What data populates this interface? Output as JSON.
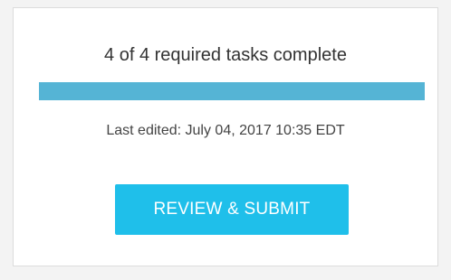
{
  "card": {
    "summary": "4 of 4 required tasks complete",
    "progress": {
      "completed": 4,
      "required": 4,
      "fraction": 1.0,
      "color": "#55b4d5"
    },
    "last_edited": "Last edited: July 04, 2017 10:35 EDT",
    "submit_label": "REVIEW & SUBMIT",
    "submit_color": "#1fbfea"
  }
}
